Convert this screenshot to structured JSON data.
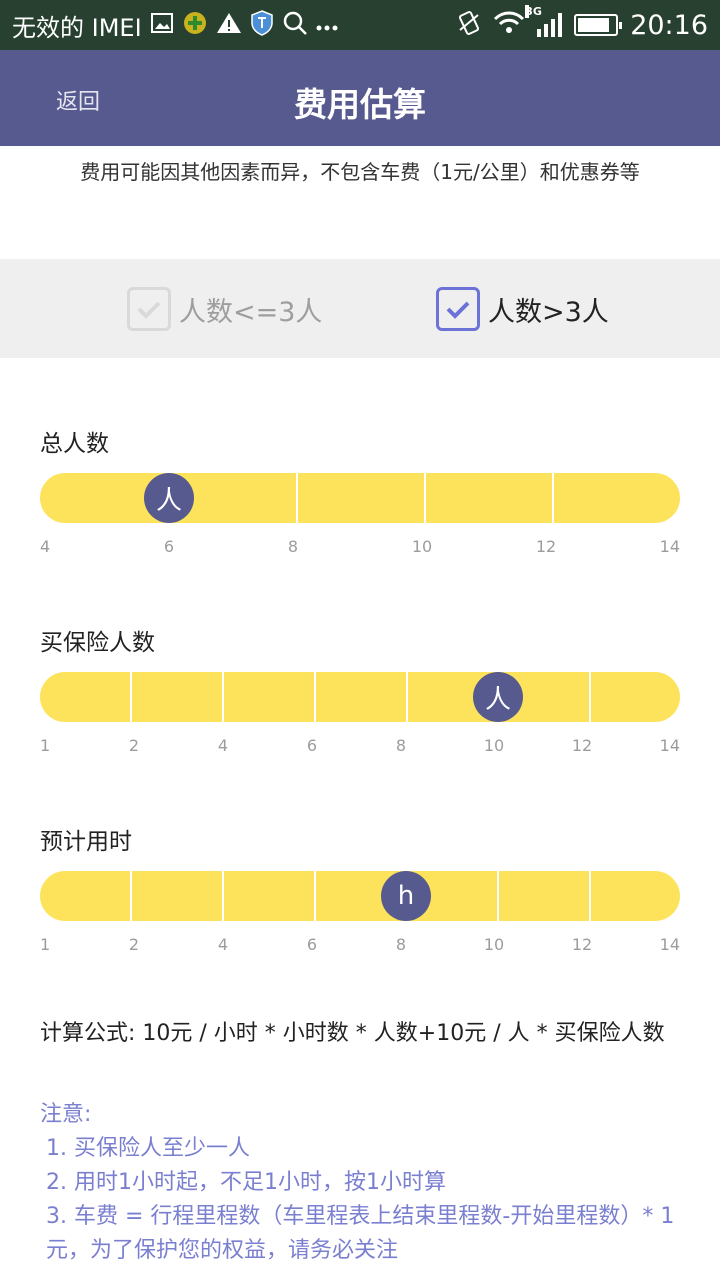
{
  "status_bar": {
    "carrier": "无效的 IMEI",
    "time": "20:16",
    "network": "3G",
    "battery_level": 0.85,
    "icons": [
      "image-icon",
      "app-icon",
      "warning-icon",
      "shield-icon",
      "search-icon",
      "more-icon",
      "vibrate-icon",
      "wifi-icon",
      "signal-icon",
      "battery-icon"
    ]
  },
  "header": {
    "back_label": "返回",
    "title": "费用估算"
  },
  "notice": "费用可能因其他因素而异，不包含车费（1元/公里）和优惠券等",
  "group_options": [
    {
      "label": "人数<=3人",
      "checked": false
    },
    {
      "label": "人数>3人",
      "checked": true
    }
  ],
  "sliders": {
    "total_people": {
      "label": "总人数",
      "thumb_text": "人",
      "ticks": [
        "4",
        "6",
        "8",
        "10",
        "12",
        "14"
      ],
      "value": 6
    },
    "insured_people": {
      "label": "买保险人数",
      "thumb_text": "人",
      "ticks": [
        "1",
        "2",
        "4",
        "6",
        "8",
        "10",
        "12",
        "14"
      ],
      "value": 10
    },
    "estimated_hours": {
      "label": "预计用时",
      "thumb_text": "h",
      "ticks": [
        "1",
        "2",
        "4",
        "6",
        "8",
        "10",
        "12",
        "14"
      ],
      "value": 8
    }
  },
  "formula": "计算公式: 10元 / 小时 * 小时数 * 人数+10元 / 人 * 买保险人数",
  "notes": {
    "title": "注意:",
    "items": [
      "1. 买保险人至少一人",
      "2. 用时1小时起，不足1小时，按1小时算",
      "3. 车费 = 行程里程数（车里程表上结束里程数-开始里程数）* 1元，为了保护您的权益，请务必关注"
    ]
  },
  "colors": {
    "header": "#575a8f",
    "track": "#fde35c",
    "accent": "#6c72d6",
    "note_text": "#7a7fd0"
  }
}
